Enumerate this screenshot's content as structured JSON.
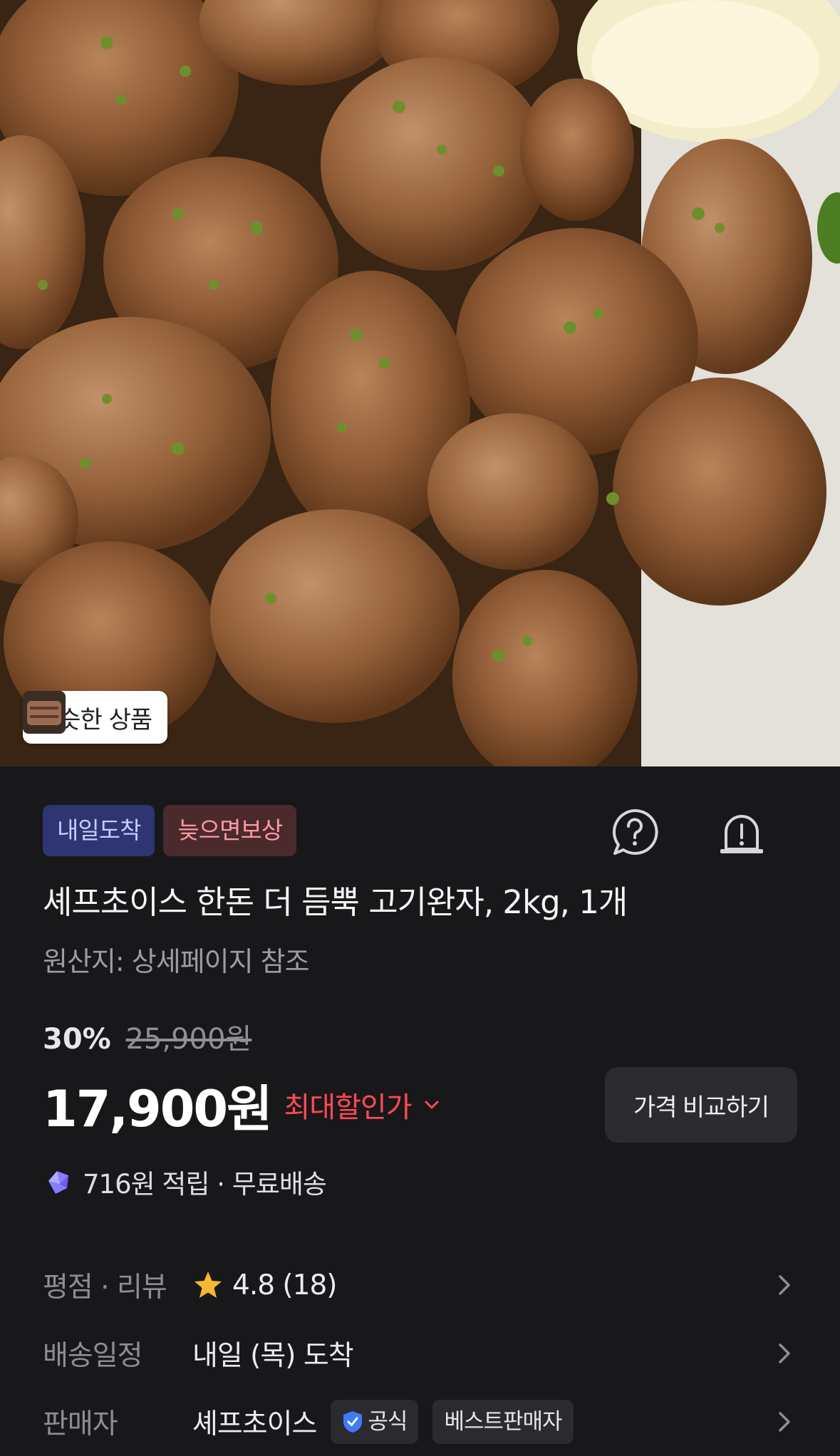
{
  "hero": {
    "similar_label": "비슷한 상품",
    "thumbnails": [
      "meatball-thumb",
      "ground-meat-thumb",
      "grilled-meat-thumb"
    ]
  },
  "badges": {
    "arrival": "내일도착",
    "late_comp": "늦으면보상"
  },
  "product": {
    "title": "셰프초이스 한돈 더 듬뿍 고기완자, 2kg, 1개",
    "origin": "원산지: 상세페이지 참조"
  },
  "pricing": {
    "discount": "30%",
    "original_price": "25,900원",
    "price": "17,900원",
    "max_discount_label": "최대할인가",
    "compare_button": "가격 비교하기"
  },
  "points": {
    "text": "716원 적립 · 무료배송"
  },
  "info": {
    "rating_label": "평점 · 리뷰",
    "rating_value": "4.8 (18)",
    "delivery_label": "배송일정",
    "delivery_value": "내일 (목) 도착",
    "seller_label": "판매자",
    "seller_value": "셰프초이스",
    "official_badge": "공식",
    "best_seller_badge": "베스트판매자"
  },
  "colors": {
    "background": "#18181b",
    "accent_red": "#ff4a55",
    "badge_blue_bg": "#2f3472",
    "badge_red_bg": "#4a2a2d",
    "star": "#f7b731"
  },
  "icons": [
    "help-circle-icon",
    "siren-alert-icon",
    "chevron-down-icon",
    "points-gem-icon",
    "star-icon",
    "chevron-right-icon",
    "shield-check-icon"
  ]
}
